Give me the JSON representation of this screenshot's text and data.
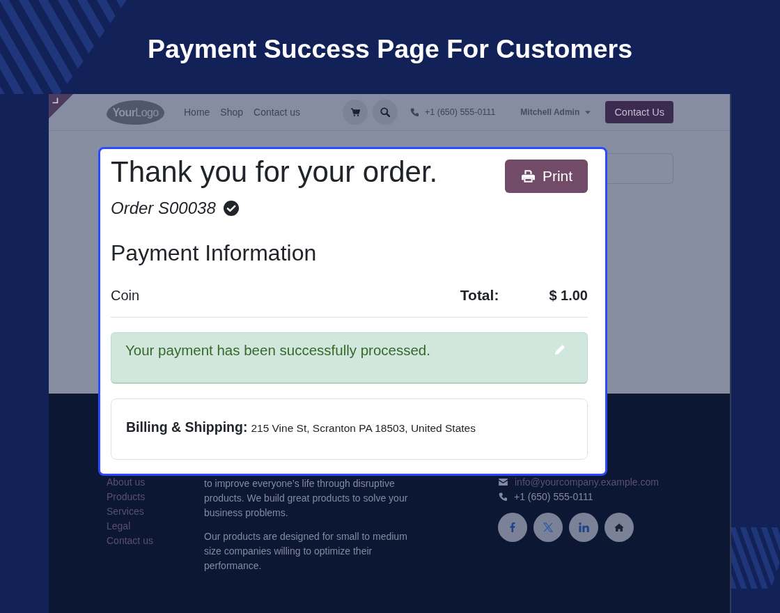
{
  "title": "Payment Success Page For Customers",
  "site": {
    "logo": "**Your**Logo",
    "nav": [
      "Home",
      "Shop",
      "Contact us"
    ],
    "phone": "+1 (650) 555-0111",
    "user": "Mitchell Admin",
    "contact_button": "Contact Us"
  },
  "order_dialog": {
    "heading": "Thank you for your order.",
    "print_button": "Print",
    "order": "Order S00038",
    "section_title": "Payment Information",
    "payment_method": "Coin",
    "total_label": "Total:",
    "total": "$ 1.00",
    "alert": "Your payment has been successfully processed.",
    "billing_label": "Billing & Shipping:",
    "billing_address": "215 Vine St, Scranton PA 18503, United States"
  },
  "footer": {
    "links": [
      "About us",
      "Products",
      "Services",
      "Legal",
      "Contact us"
    ],
    "about": [
      "to improve everyone’s life through disruptive products. We build great products to solve your business problems.",
      "Our products are designed for small to medium size companies willing to optimize their performance."
    ],
    "email": "info@yourcompany.example.com",
    "phone": "+1 (650) 555-0111",
    "social": [
      {
        "kind": "facebook"
      },
      {
        "kind": "x"
      },
      {
        "kind": "linkedin"
      },
      {
        "kind": "home"
      }
    ]
  }
}
